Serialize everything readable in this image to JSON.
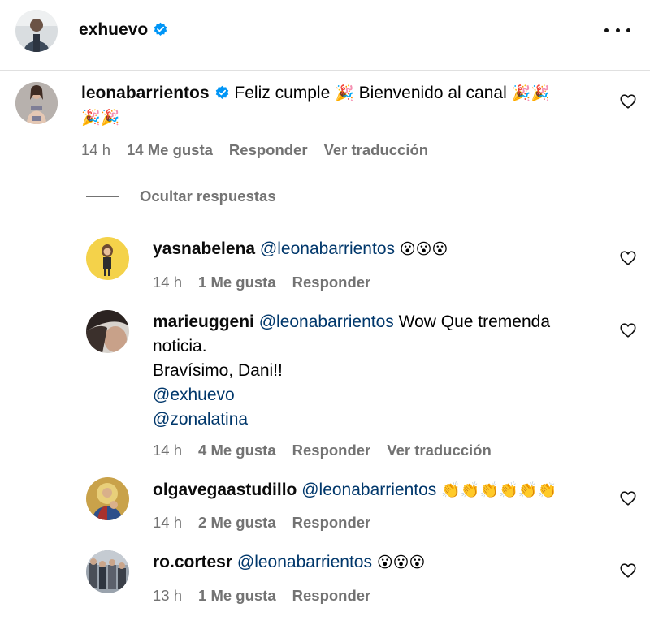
{
  "post": {
    "author": "exhuevo",
    "verified": true
  },
  "comment": {
    "username": "leonabarrientos",
    "verified": true,
    "text_1": "Feliz cumple",
    "emoji_1": "🎉",
    "text_2": "Bienvenido al canal",
    "emoji_2": "🎉🎉",
    "emoji_line2": "🎉🎉",
    "time": "14 h",
    "likes": "14 Me gusta",
    "reply": "Responder",
    "translate": "Ver traducción"
  },
  "hide_replies": "Ocultar respuestas",
  "replies": [
    {
      "username": "yasnabelena",
      "mention": "@leonabarrientos",
      "text": "😮😮😮",
      "time": "14 h",
      "likes": "1 Me gusta",
      "reply": "Responder"
    },
    {
      "username": "marieuggeni",
      "mention": "@leonabarrientos",
      "text_line1": "Wow Que tremenda",
      "text_line2": "noticia.",
      "text_line3": "Bravísimo, Dani!!",
      "mention_2": "@exhuevo",
      "mention_3": "@zonalatina",
      "time": "14 h",
      "likes": "4 Me gusta",
      "reply": "Responder",
      "translate": "Ver traducción"
    },
    {
      "username": "olgavegaastudillo",
      "mention": "@leonabarrientos",
      "text": "👏👏👏👏👏👏",
      "time": "14 h",
      "likes": "2 Me gusta",
      "reply": "Responder"
    },
    {
      "username": "ro.cortesr",
      "mention": "@leonabarrientos",
      "text": "😮😮😮",
      "time": "13 h",
      "likes": "1 Me gusta",
      "reply": "Responder"
    }
  ],
  "icons": {
    "verified": "verified-badge-icon",
    "heart": "heart-outline-icon",
    "more": "more-options-icon"
  },
  "colors": {
    "verified": "#0095f6",
    "mention": "#00376b",
    "meta": "#737373"
  }
}
